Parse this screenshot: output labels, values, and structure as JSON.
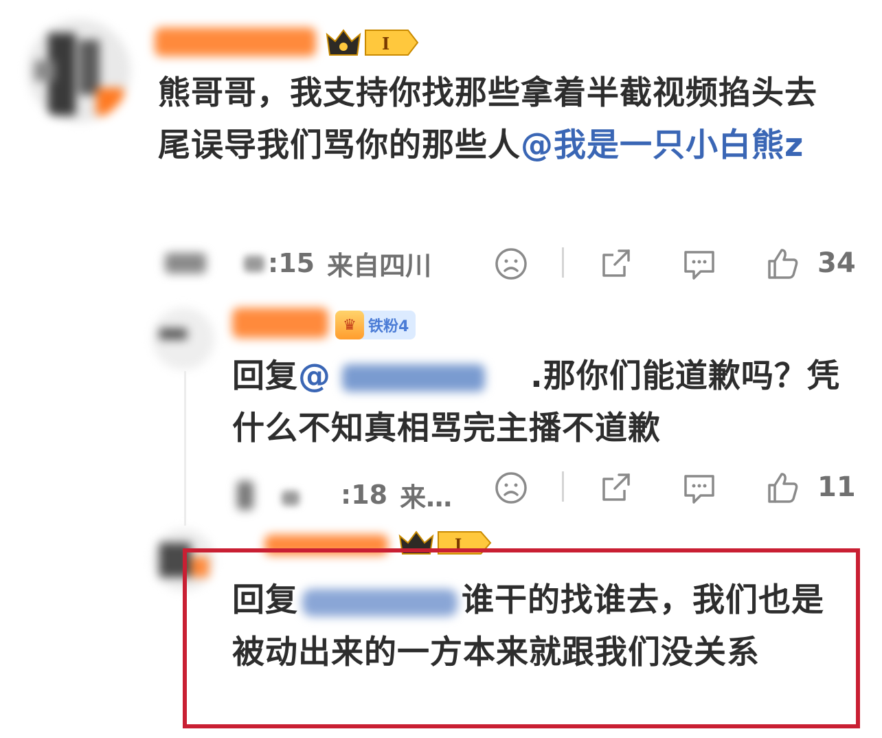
{
  "main_comment": {
    "badge_level": "I",
    "text": "熊哥哥，我支持你找那些拿着半截视频掐头去尾误导我们骂你的那些人",
    "mention": "@我是一只小白熊z",
    "time": ":15",
    "location": "来自四川",
    "likes": "34"
  },
  "reply1": {
    "badge_label": "铁粉4",
    "reply_prefix": "回复",
    "mention_visible": "@",
    "mention_tail": "",
    "text": ".那你们能道歉吗？凭什么不知真相骂完主播不道歉",
    "time": ":18",
    "location": "来…",
    "likes": "11"
  },
  "reply2": {
    "badge_level": "I",
    "reply_prefix": "回复",
    "text": "谁干的找谁去，我们也是被动出来的一方本来就跟我们没关系"
  },
  "icons": [
    "sad-face-icon",
    "share-icon",
    "comment-icon",
    "like-icon"
  ],
  "colors": {
    "mention": "#3a66b5",
    "highlight_border": "#c91f33",
    "name_blur": "#ff8a3c"
  }
}
